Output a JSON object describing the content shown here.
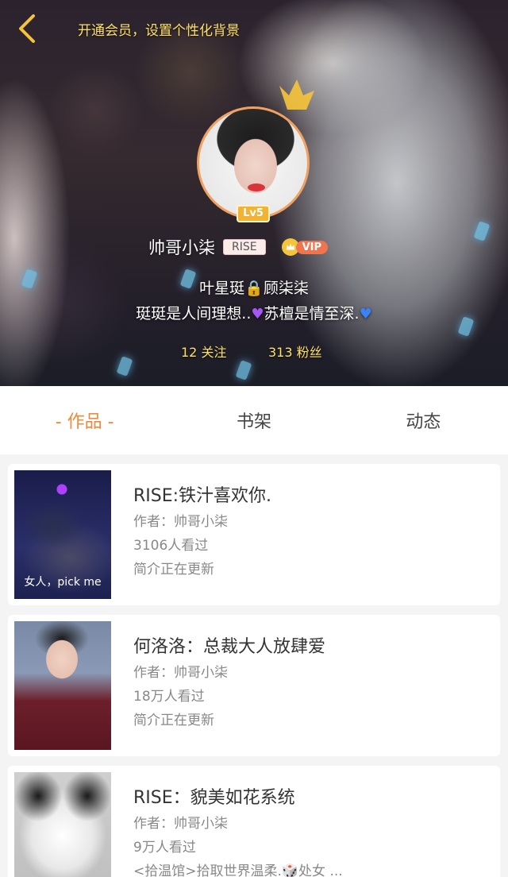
{
  "header": {
    "vip_background_link": "开通会员，设置个性化背景",
    "level": "Lv5",
    "username": "帅哥小柒",
    "user_tag": "RISE",
    "vip_label": "VIP",
    "bio_line1": "叶星珽🔒顾柒柒",
    "bio_line2_text": "珽珽是人间理想..",
    "bio_line2_mid": "苏檀是情至深.",
    "following": "12 关注",
    "fans": "313 粉丝",
    "icons": {
      "back": "chevron-left-icon",
      "vip": "crown-icon",
      "heart_purple": "purple-heart-icon",
      "heart_blue": "blue-heart-icon"
    }
  },
  "tabs": [
    {
      "label": "- 作品 -",
      "active": true
    },
    {
      "label": "书架",
      "active": false
    },
    {
      "label": "动态",
      "active": false
    }
  ],
  "works": [
    {
      "title": "RISE:铁汁喜欢你.",
      "author": "作者：帅哥小柒",
      "views": "3106人看过",
      "status": "简介正在更新",
      "cover_caption": "女人，pick me"
    },
    {
      "title": "何洛洛：总裁大人放肆爱",
      "author": "作者：帅哥小柒",
      "views": "18万人看过",
      "status": "简介正在更新",
      "cover_caption": ""
    },
    {
      "title": "RISE：貌美如花系统",
      "author": "作者：帅哥小柒",
      "views": "9万人看过",
      "status": "<拾温馆>拾取世界温柔.🎲处女 ...",
      "cover_caption": ""
    }
  ],
  "colors": {
    "accent": "#f08a3a",
    "vip_gold": "#ffe066",
    "card_bg": "#ffffff",
    "page_bg": "#f4f4f4"
  }
}
